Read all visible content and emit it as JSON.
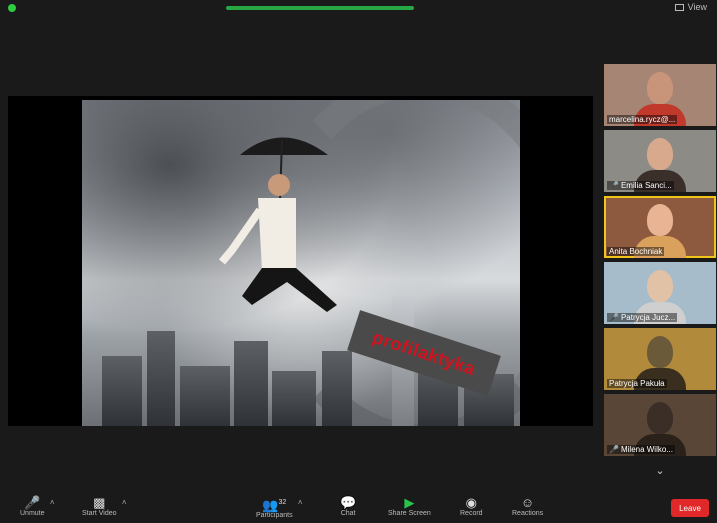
{
  "top": {
    "view_label": "View"
  },
  "slide": {
    "banner_text": "profilaktyka"
  },
  "participants": [
    {
      "name": "marcelina.rycz@...",
      "muted": false,
      "face": "#c9957a",
      "body": "#c0392b",
      "bg": "#a78574"
    },
    {
      "name": "Emilia Sanci...",
      "muted": true,
      "face": "#d8a98d",
      "body": "#3b2f2a",
      "bg": "#8d8b86"
    },
    {
      "name": "Anita Bochniak",
      "muted": false,
      "face": "#e8b494",
      "body": "#d9a15c",
      "bg": "#8e5a3f",
      "active": true
    },
    {
      "name": "Patrycja Jucz...",
      "muted": true,
      "face": "#e2c2a6",
      "body": "#cfcfcf",
      "bg": "#a7bccb"
    },
    {
      "name": "Patrycja Pakuła",
      "muted": false,
      "face": "#6b5a3a",
      "body": "#3a2e1e",
      "bg": "#b18a3c"
    },
    {
      "name": "Milena Wilko...",
      "muted": true,
      "face": "#3a2e26",
      "body": "#2a211a",
      "bg": "#5a4636"
    }
  ],
  "toolbar": {
    "unmute": "Unmute",
    "start_video": "Start Video",
    "participants": "Participants",
    "participants_count": "32",
    "chat": "Chat",
    "share_screen": "Share Screen",
    "record": "Record",
    "reactions": "Reactions",
    "leave": "Leave"
  }
}
